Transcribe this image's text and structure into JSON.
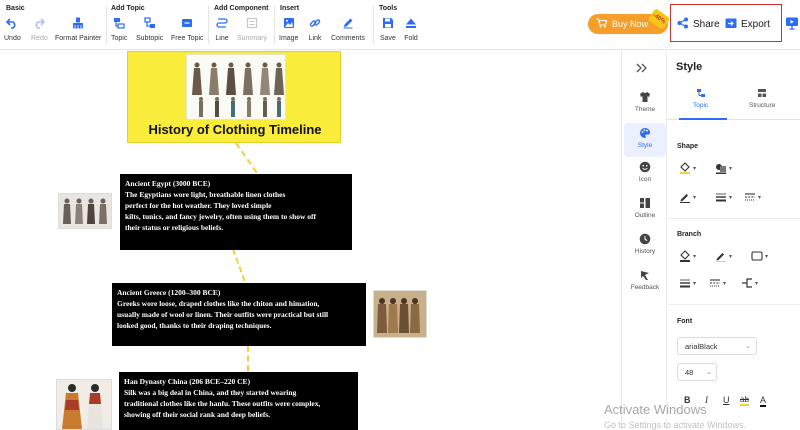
{
  "toolbar": {
    "groups": {
      "basic": "Basic",
      "add_topic": "Add Topic",
      "add_component": "Add Component",
      "insert": "Insert",
      "tools": "Tools"
    },
    "tools": {
      "undo": "Undo",
      "redo": "Redo",
      "format_painter": "Format Painter",
      "topic": "Topic",
      "subtopic": "Subtopic",
      "free_topic": "Free Topic",
      "line": "Line",
      "summary": "Summary",
      "image": "Image",
      "link": "Link",
      "comments": "Comments",
      "save": "Save",
      "fold": "Fold"
    },
    "buy_now": "Buy Now",
    "buy_badge": "-40%",
    "share": "Share",
    "export": "Export"
  },
  "canvas": {
    "title": "History of Clothing Timeline",
    "topics": [
      {
        "title": "Ancient Egypt (3000 BCE)",
        "lines": [
          " The Egyptians wore light, breathable linen clothes",
          "perfect for the hot weather. They loved simple",
          "kilts, tunics, and fancy jewelry, often using them to show off",
          "their status or religious beliefs."
        ]
      },
      {
        "title": "Ancient Greece (1200–300 BCE)",
        "lines": [
          "Greeks wore loose, draped clothes like the chiton and himation,",
          "usually made of wool or linen. Their outfits were practical but still",
          " looked good, thanks to their draping techniques."
        ]
      },
      {
        "title": "Han Dynasty China (206 BCE–220 CE)",
        "lines": [
          "Silk was a big deal in China, and they started wearing",
          "traditional clothes like the hanfu. These outfits were complex,",
          "showing off their social rank and deep beliefs."
        ]
      }
    ],
    "watermark": {
      "line1": "Activate Windows",
      "line2": "Go to Settings to activate Windows."
    }
  },
  "rail": {
    "items": [
      "Theme",
      "Style",
      "Icon",
      "Outline",
      "History",
      "Feedback"
    ]
  },
  "panel": {
    "title": "Style",
    "tabs": [
      "Topic",
      "Structure"
    ],
    "sections": {
      "shape": "Shape",
      "branch": "Branch",
      "font": "Font"
    },
    "font_family": "arialBlack",
    "font_size": "48",
    "format": {
      "bold": "B",
      "italic": "I",
      "underline": "U",
      "strike": "ab",
      "color": "A"
    }
  },
  "colors": {
    "accent": "#2d6cf6",
    "title_bg": "#f9ec3a",
    "topic_bg": "#000000",
    "buy_now": "#f59e2a",
    "highlight_frame": "#d0312d"
  }
}
